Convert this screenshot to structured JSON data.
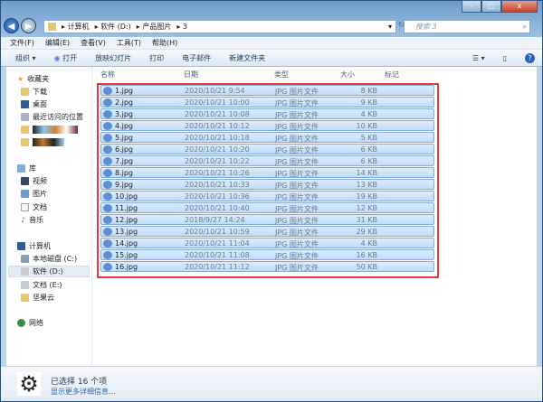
{
  "window": {
    "minimize": "–",
    "maximize": "□",
    "close": "x"
  },
  "address": {
    "crumbs": [
      "计算机",
      "软件 (D:)",
      "产品图片",
      "3"
    ],
    "search_placeholder": "搜索 3"
  },
  "menu": [
    "文件(F)",
    "编辑(E)",
    "查看(V)",
    "工具(T)",
    "帮助(H)"
  ],
  "toolbar": [
    "组织 ▾",
    "打开",
    "放映幻灯片",
    "打印",
    "电子邮件",
    "新建文件夹"
  ],
  "sidebar": {
    "favorites": {
      "label": "收藏夹",
      "items": [
        "下载",
        "桌面",
        "最近访问的位置"
      ]
    },
    "libraries": {
      "label": "库",
      "items": [
        "视频",
        "图片",
        "文档",
        "音乐"
      ]
    },
    "computer": {
      "label": "计算机",
      "items": [
        "本地磁盘 (C:)",
        "软件 (D:)",
        "文档 (E:)",
        "坚果云"
      ]
    },
    "network": {
      "label": "网络"
    }
  },
  "columns": [
    "名称",
    "日期",
    "类型",
    "大小",
    "标记"
  ],
  "files": [
    [
      "1.jpg",
      "2020/10/21 9:54",
      "JPG 图片文件",
      "8 KB"
    ],
    [
      "2.jpg",
      "2020/10/21 10:00",
      "JPG 图片文件",
      "9 KB"
    ],
    [
      "3.jpg",
      "2020/10/21 10:08",
      "JPG 图片文件",
      "4 KB"
    ],
    [
      "4.jpg",
      "2020/10/21 10:12",
      "JPG 图片文件",
      "10 KB"
    ],
    [
      "5.jpg",
      "2020/10/21 10:18",
      "JPG 图片文件",
      "5 KB"
    ],
    [
      "6.jpg",
      "2020/10/21 10:20",
      "JPG 图片文件",
      "6 KB"
    ],
    [
      "7.jpg",
      "2020/10/21 10:22",
      "JPG 图片文件",
      "6 KB"
    ],
    [
      "8.jpg",
      "2020/10/21 10:26",
      "JPG 图片文件",
      "14 KB"
    ],
    [
      "9.jpg",
      "2020/10/21 10:33",
      "JPG 图片文件",
      "13 KB"
    ],
    [
      "10.jpg",
      "2020/10/21 10:36",
      "JPG 图片文件",
      "19 KB"
    ],
    [
      "11.jpg",
      "2020/10/21 10:40",
      "JPG 图片文件",
      "12 KB"
    ],
    [
      "12.jpg",
      "2018/9/27 14:24",
      "JPG 图片文件",
      "31 KB"
    ],
    [
      "13.jpg",
      "2020/10/21 10:59",
      "JPG 图片文件",
      "29 KB"
    ],
    [
      "14.jpg",
      "2020/10/21 11:04",
      "JPG 图片文件",
      "4 KB"
    ],
    [
      "15.jpg",
      "2020/10/21 11:08",
      "JPG 图片文件",
      "16 KB"
    ],
    [
      "16.jpg",
      "2020/10/21 11:12",
      "JPG 图片文件",
      "50 KB"
    ]
  ],
  "details": {
    "status": "已选择 16 个项",
    "more": "显示更多详细信息..."
  }
}
